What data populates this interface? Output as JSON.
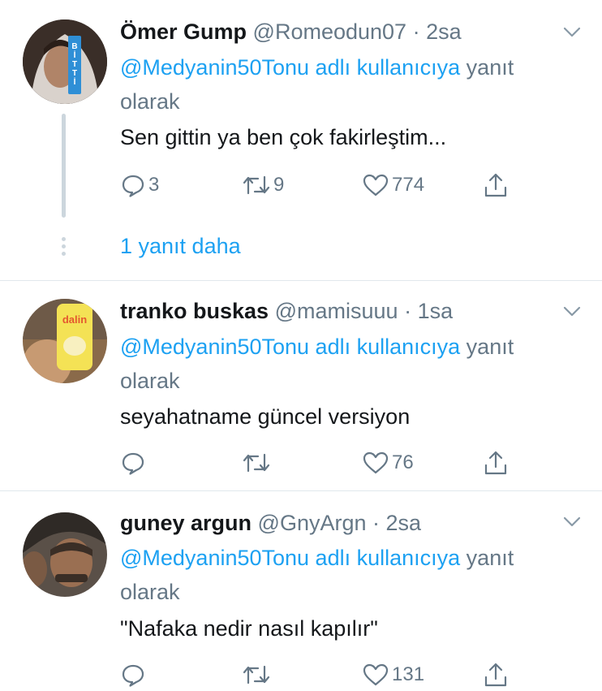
{
  "colors": {
    "accent": "#1da1f2",
    "muted": "#657786",
    "text": "#14171a",
    "divider": "#e1e8ed"
  },
  "tweets": [
    {
      "name": "Ömer Gump",
      "handle": "@Romeodun07",
      "sep": "·",
      "time": "2sa",
      "reply_mention": "@Medyanin50Tonu adlı kullanıcıya",
      "reply_suffix": " yanıt olarak",
      "text": "Sen gittin ya ben çok fakirleştim...",
      "replies": "3",
      "retweets": "9",
      "likes": "774",
      "avatar_badge": [
        "B",
        "İ",
        "T",
        "T",
        "İ"
      ]
    },
    {
      "name": "tranko buskas",
      "handle": "@mamisuuu",
      "sep": "·",
      "time": "1sa",
      "reply_mention": "@Medyanin50Tonu adlı kullanıcıya",
      "reply_suffix": " yanıt olarak",
      "text": "seyahatname güncel versiyon",
      "replies": "",
      "retweets": "",
      "likes": "76",
      "avatar_label": "dalin"
    },
    {
      "name": "guney argun",
      "handle": "@GnyArgn",
      "sep": "·",
      "time": "2sa",
      "reply_mention": "@Medyanin50Tonu adlı kullanıcıya",
      "reply_suffix": " yanıt olarak",
      "text": "\"Nafaka nedir nasıl kapılır\"",
      "replies": "",
      "retweets": "",
      "likes": "131"
    }
  ],
  "thread": {
    "more_replies": "1 yanıt daha"
  },
  "icons": [
    "reply-icon",
    "retweet-icon",
    "like-icon",
    "share-icon",
    "chevron-down-icon"
  ]
}
